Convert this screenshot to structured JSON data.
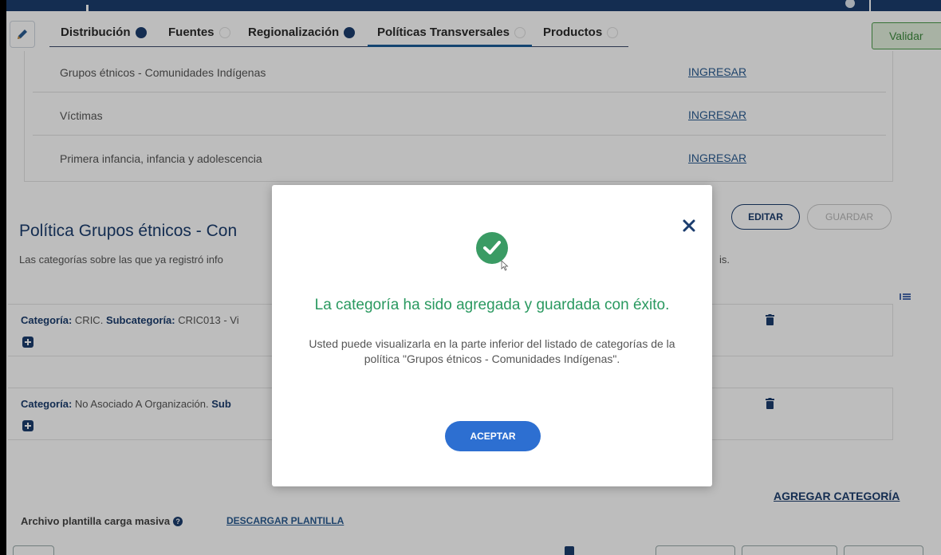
{
  "header": {
    "tabs": [
      {
        "label": "Distribución",
        "status": "filled"
      },
      {
        "label": "Fuentes",
        "status": "empty"
      },
      {
        "label": "Regionalización",
        "status": "filled"
      },
      {
        "label": "Políticas Transversales",
        "status": "empty",
        "active": true
      },
      {
        "label": "Productos",
        "status": "empty"
      }
    ],
    "validar_label": "Validar",
    "edit_icon": "pencil-icon"
  },
  "policies": [
    {
      "name": "Grupos étnicos - Comunidades Indígenas",
      "action": "INGRESAR"
    },
    {
      "name": "Víctimas",
      "action": "INGRESAR"
    },
    {
      "name": "Primera infancia, infancia y adolescencia",
      "action": "INGRESAR"
    }
  ],
  "section": {
    "title": "Política Grupos étnicos - Con",
    "subtitle": "Las categorías sobre las que ya registró info",
    "subtitle_tail": "is.",
    "editar_label": "EDITAR",
    "guardar_label": "GUARDAR"
  },
  "categories": [
    {
      "cat_key": "Categoría:",
      "cat_value": "CRIC.",
      "sub_key": "Subcategoría:",
      "sub_value": "CRIC013 - Vi"
    },
    {
      "cat_key": "Categoría:",
      "cat_value": "No Asociado A Organización.",
      "sub_key": "Sub",
      "sub_value": ""
    }
  ],
  "footer": {
    "agregar_label": "AGREGAR CATEGORÍA",
    "archivo_label": "Archivo plantilla carga masiva",
    "descargar_label": "DESCARGAR PLANTILLA"
  },
  "modal": {
    "title": "La categoría ha sido agregada y guardada con éxito.",
    "body": "Usted puede visualizarla en la parte inferior del listado de categorías de la política \"Grupos étnicos - Comunidades Indígenas\".",
    "accept_label": "ACEPTAR",
    "close_icon": "close-icon",
    "success_icon": "check-circle-icon"
  },
  "colors": {
    "primary": "#1b3d6e",
    "success": "#2a9960",
    "accent_button": "#2d6fd1",
    "validar_bg": "#e3f1de"
  }
}
